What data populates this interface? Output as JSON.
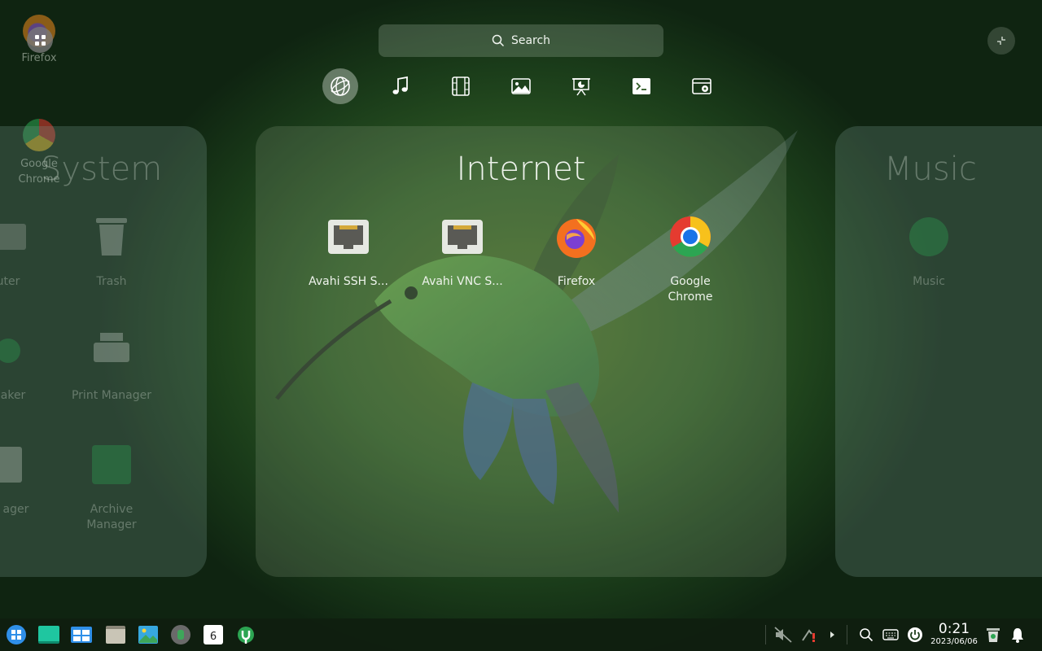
{
  "desktop": {
    "icons": [
      {
        "label": "Firefox"
      },
      {
        "label": "Google Chrome"
      }
    ]
  },
  "search": {
    "label": "Search"
  },
  "categories": [
    {
      "icon": "internet-icon",
      "active": true
    },
    {
      "icon": "music-icon"
    },
    {
      "icon": "video-icon"
    },
    {
      "icon": "image-icon"
    },
    {
      "icon": "presentation-icon"
    },
    {
      "icon": "terminal-icon"
    },
    {
      "icon": "system-tools-icon"
    }
  ],
  "panels": {
    "left": {
      "title": "System",
      "apps": [
        {
          "label": "Computer",
          "display": "uter"
        },
        {
          "label": "Trash"
        },
        {
          "label": "Boot Maker",
          "display": "Maker"
        },
        {
          "label": "Print Manager"
        },
        {
          "label": "Font Manager",
          "display": "nt ager"
        },
        {
          "label": "Archive Manager"
        }
      ]
    },
    "center": {
      "title": "Internet",
      "apps": [
        {
          "label": "Avahi SSH S..."
        },
        {
          "label": "Avahi VNC S..."
        },
        {
          "label": "Firefox"
        },
        {
          "label": "Google Chrome"
        }
      ]
    },
    "right": {
      "title": "Music",
      "apps": [
        {
          "label": "Music"
        }
      ]
    }
  },
  "taskbar": {
    "clock_time": "0:21",
    "clock_date": "2023/06/06",
    "calendar_day": "6"
  },
  "colors": {
    "accent_green": "#1fc6a0",
    "bg_dark": "#0f2411"
  }
}
